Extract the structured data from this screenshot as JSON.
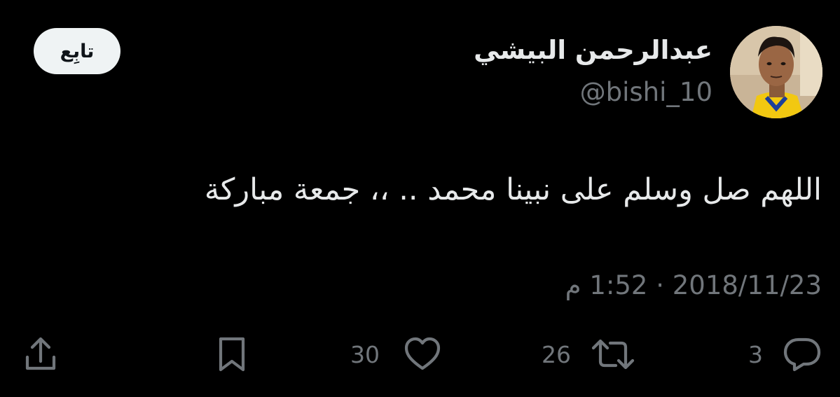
{
  "author": {
    "display_name": "عبدالرحمن البيشي",
    "handle": "@bishi_10",
    "avatar_icon": "profile-photo"
  },
  "follow_button": {
    "label": "تابِع"
  },
  "tweet": {
    "text": "اللهم صل وسلم على نبينا محمد .. ،، جمعة مباركة",
    "timestamp": "2018/11/23 · 1:52 م"
  },
  "actions": {
    "reply": {
      "icon": "speech-bubble-icon",
      "count": "3"
    },
    "retweet": {
      "icon": "retweet-arrows-icon",
      "count": "26"
    },
    "like": {
      "icon": "heart-icon",
      "count": "30"
    },
    "bookmark": {
      "icon": "bookmark-icon"
    },
    "share": {
      "icon": "share-upload-icon"
    }
  },
  "colors": {
    "background": "#000000",
    "primary_text": "#e7e9ea",
    "secondary_text": "#71767b",
    "follow_button_bg": "#eff3f4",
    "follow_button_text": "#0f1419"
  }
}
